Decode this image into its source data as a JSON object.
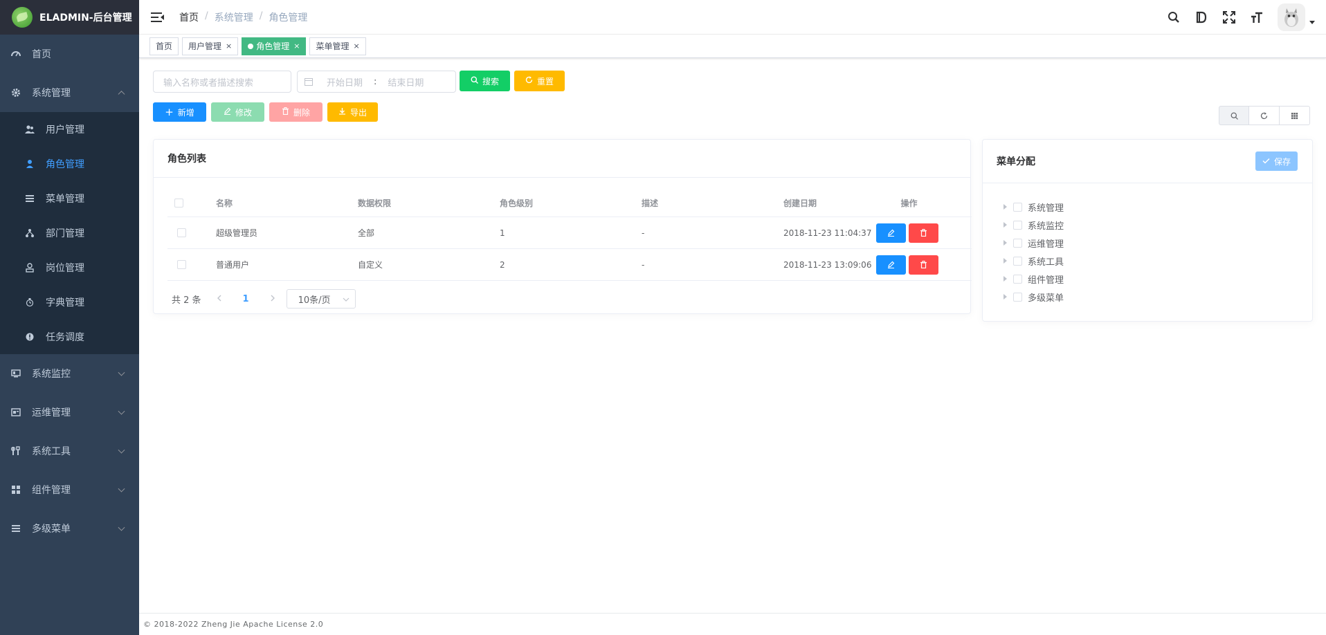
{
  "app": {
    "title": "ELADMIN-后台管理"
  },
  "sidebar": {
    "items": [
      {
        "label": "首页",
        "icon": "dashboard-icon"
      },
      {
        "label": "系统管理",
        "icon": "gear-icon",
        "expanded": true,
        "children": [
          {
            "label": "用户管理",
            "icon": "users-icon"
          },
          {
            "label": "角色管理",
            "icon": "role-icon",
            "active": true
          },
          {
            "label": "菜单管理",
            "icon": "menu-icon"
          },
          {
            "label": "部门管理",
            "icon": "dept-icon"
          },
          {
            "label": "岗位管理",
            "icon": "post-icon"
          },
          {
            "label": "字典管理",
            "icon": "dict-icon"
          },
          {
            "label": "任务调度",
            "icon": "timing-icon"
          }
        ]
      },
      {
        "label": "系统监控",
        "icon": "monitor-icon"
      },
      {
        "label": "运维管理",
        "icon": "ops-icon"
      },
      {
        "label": "系统工具",
        "icon": "tools-icon"
      },
      {
        "label": "组件管理",
        "icon": "component-icon"
      },
      {
        "label": "多级菜单",
        "icon": "list-icon"
      }
    ]
  },
  "breadcrumb": [
    "首页",
    "/",
    "系统管理",
    "/",
    "角色管理"
  ],
  "tags": [
    {
      "label": "首页"
    },
    {
      "label": "用户管理",
      "close": "×"
    },
    {
      "label": "角色管理",
      "close": "×",
      "active": true
    },
    {
      "label": "菜单管理",
      "close": "×"
    }
  ],
  "search": {
    "placeholder": "输入名称或者描述搜索",
    "date_start": "开始日期",
    "date_sep": ":",
    "date_end": "结束日期",
    "search_label": "搜索",
    "reset_label": "重置"
  },
  "toolbar": {
    "add": "新增",
    "edit": "修改",
    "delete": "删除",
    "export": "导出"
  },
  "role_card": {
    "title": "角色列表",
    "columns": [
      "名称",
      "数据权限",
      "角色级别",
      "描述",
      "创建日期",
      "操作"
    ],
    "rows": [
      {
        "name": "超级管理员",
        "scope": "全部",
        "level": "1",
        "desc": "-",
        "created": "2018-11-23 11:04:37"
      },
      {
        "name": "普通用户",
        "scope": "自定义",
        "level": "2",
        "desc": "-",
        "created": "2018-11-23 13:09:06"
      }
    ],
    "pagination": {
      "total": "共 2 条",
      "page": "1",
      "size": "10条/页"
    }
  },
  "menu_card": {
    "title": "菜单分配",
    "save": "保存",
    "tree": [
      "系统管理",
      "系统监控",
      "运维管理",
      "系统工具",
      "组件管理",
      "多级菜单"
    ]
  },
  "footer": "© 2018-2022 Zheng Jie Apache License 2.0",
  "colors": {
    "primary": "#1890ff",
    "success": "#13ce66",
    "warning": "#ffba00",
    "danger": "#ff4949",
    "sidebar": "#304156",
    "tag_active": "#42b983"
  }
}
